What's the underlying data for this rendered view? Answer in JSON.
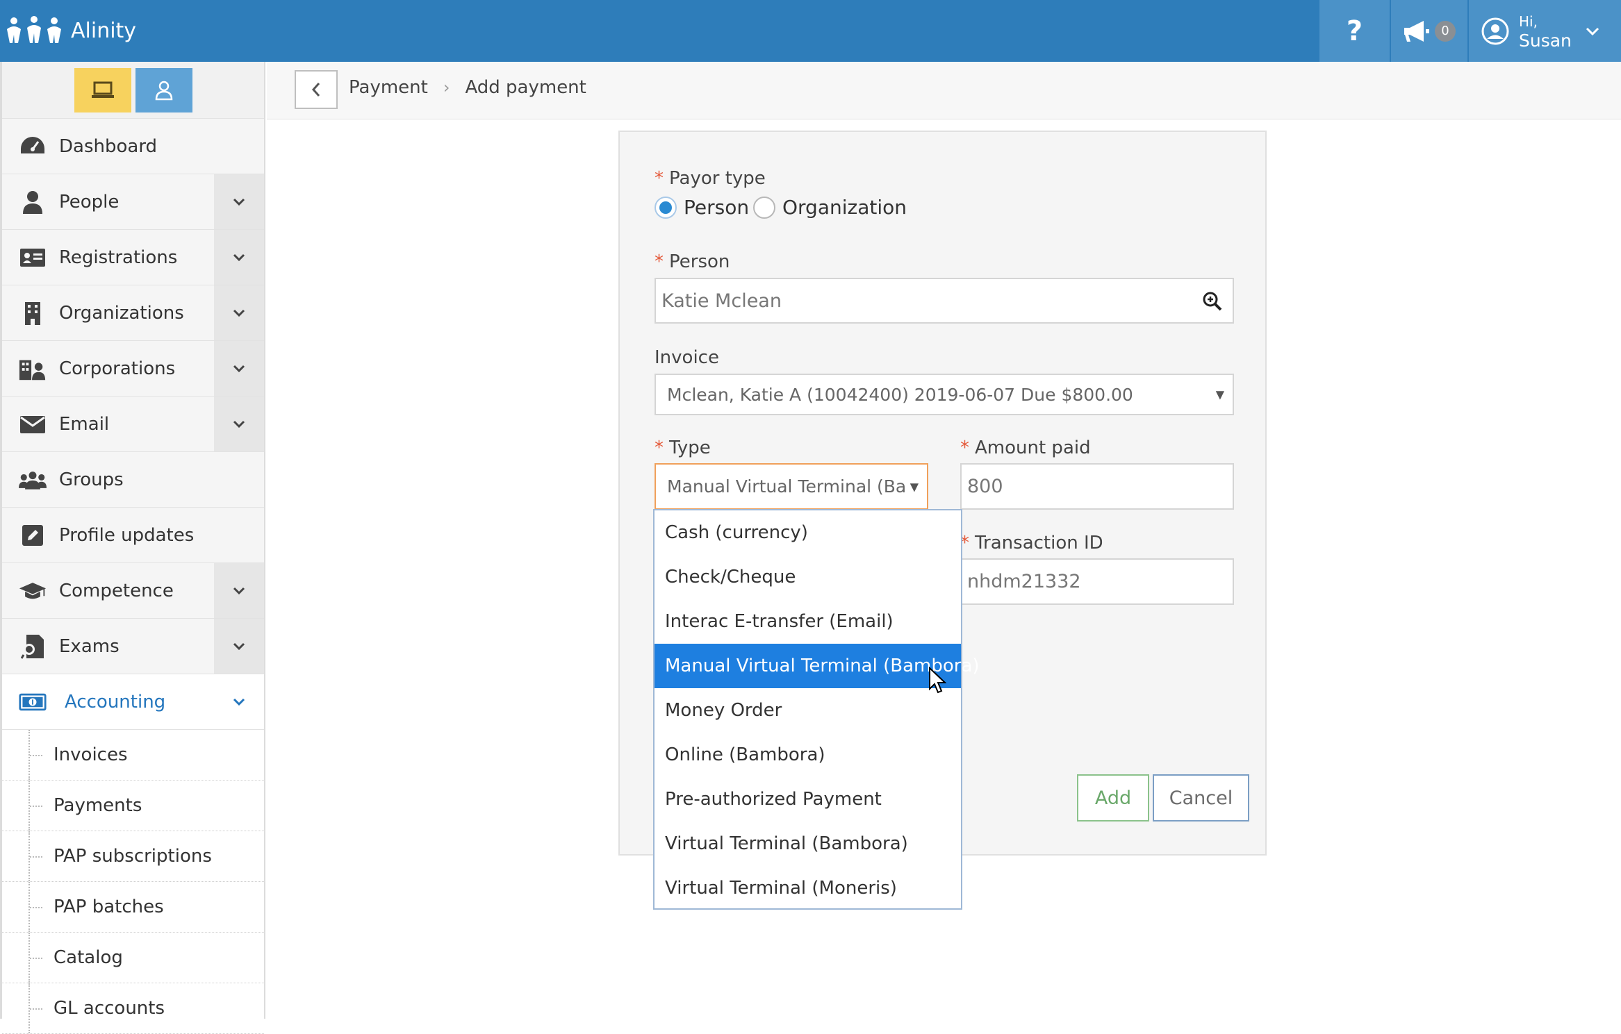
{
  "topbar": {
    "brand": "Alinity",
    "help_icon": "question-icon",
    "announcements_count": "0",
    "user_greeting": "Hi,",
    "user_name": "Susan"
  },
  "sidebar": {
    "items": [
      {
        "label": "Dashboard",
        "icon": "dashboard-icon",
        "expandable": false
      },
      {
        "label": "People",
        "icon": "person-icon",
        "expandable": true
      },
      {
        "label": "Registrations",
        "icon": "id-card-icon",
        "expandable": true
      },
      {
        "label": "Organizations",
        "icon": "building-icon",
        "expandable": true
      },
      {
        "label": "Corporations",
        "icon": "corporations-icon",
        "expandable": true
      },
      {
        "label": "Email",
        "icon": "envelope-icon",
        "expandable": true
      },
      {
        "label": "Groups",
        "icon": "users-icon",
        "expandable": false
      },
      {
        "label": "Profile updates",
        "icon": "edit-icon",
        "expandable": false
      },
      {
        "label": "Competence",
        "icon": "graduation-cap-icon",
        "expandable": true
      },
      {
        "label": "Exams",
        "icon": "exam-icon",
        "expandable": true
      },
      {
        "label": "Accounting",
        "icon": "money-icon",
        "expandable": true,
        "active": true
      }
    ],
    "accounting_sub": [
      "Invoices",
      "Payments",
      "PAP subscriptions",
      "PAP batches",
      "Catalog",
      "GL accounts"
    ]
  },
  "breadcrumb": {
    "items": [
      "Payment",
      "Add payment"
    ]
  },
  "form": {
    "payor_type_label": "Payor type",
    "payor_options": [
      "Person",
      "Organization"
    ],
    "payor_selected": "Person",
    "person_label": "Person",
    "person_value": "Katie Mclean",
    "invoice_label": "Invoice",
    "invoice_value": "Mclean, Katie A (10042400) 2019-06-07 Due $800.00",
    "type_label": "Type",
    "type_value": "Manual Virtual Terminal (Ba",
    "amount_label": "Amount paid",
    "amount_value": "800",
    "transaction_label": "Transaction ID",
    "transaction_value": "nhdm21332",
    "add_label": "Add",
    "cancel_label": "Cancel"
  },
  "type_options": [
    "Cash (currency)",
    "Check/Cheque",
    "Interac E-transfer (Email)",
    "Manual Virtual Terminal (Bambora)",
    "Money Order",
    "Online (Bambora)",
    "Pre-authorized Payment",
    "Virtual Terminal (Bambora)",
    "Virtual Terminal (Moneris)"
  ],
  "type_selected_index": 3,
  "colors": {
    "topbar": "#2e7dba",
    "accent": "#2476bd",
    "selected_option": "#1e7fe0",
    "required": "#e45a3b"
  }
}
